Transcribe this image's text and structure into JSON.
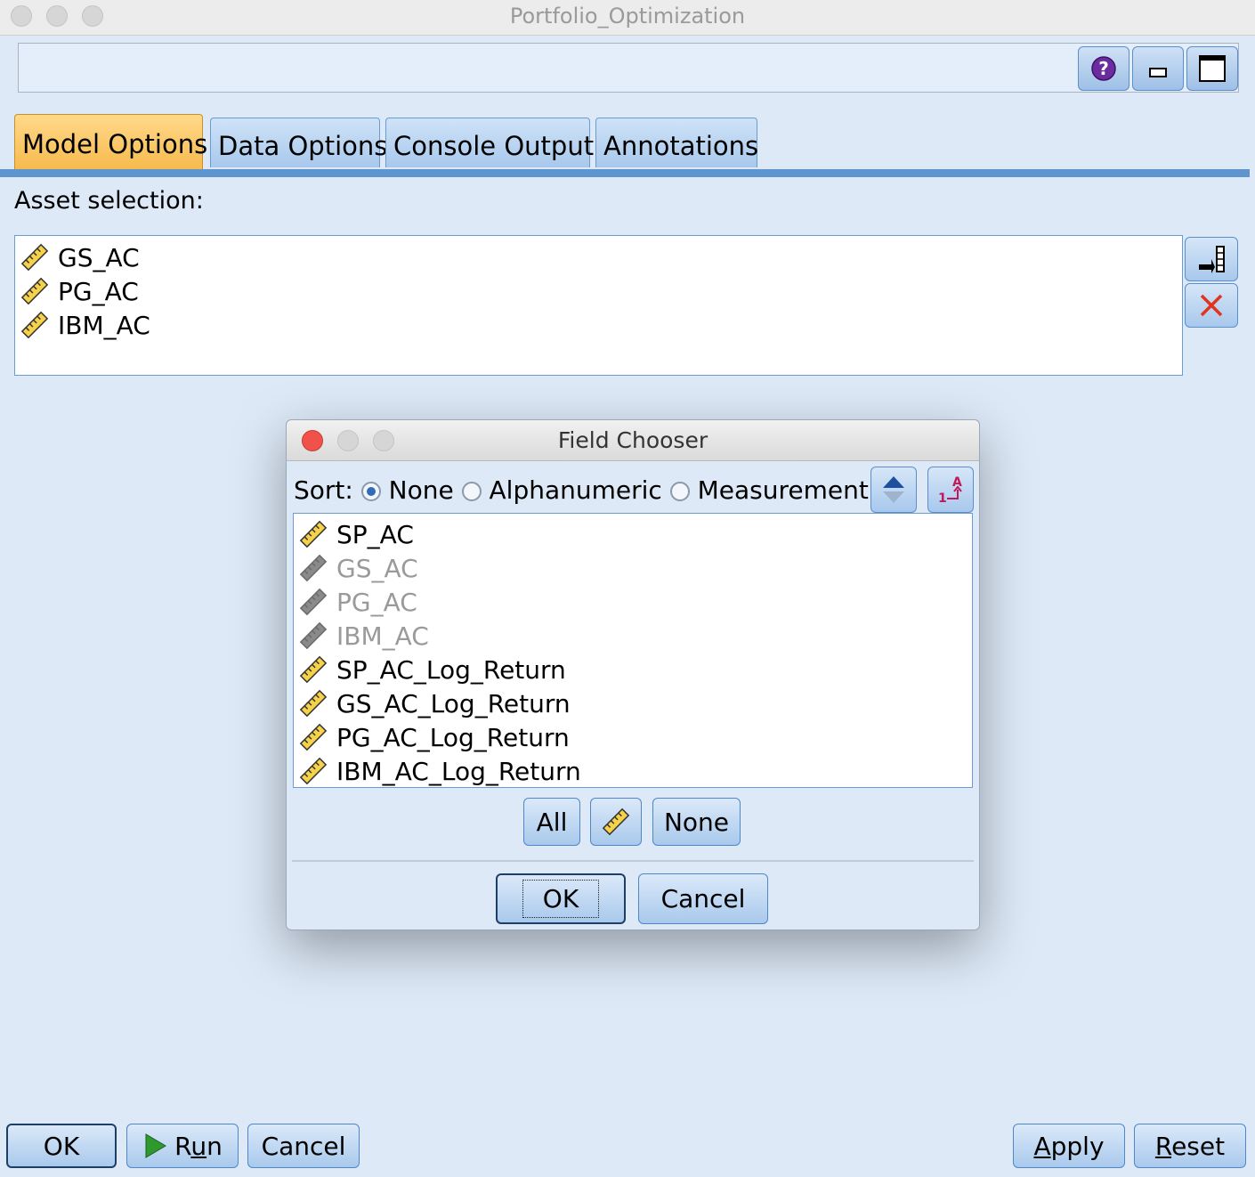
{
  "window": {
    "title": "Portfolio_Optimization"
  },
  "toolbar": {
    "help_icon": "help-icon",
    "minimize_icon": "minimize-icon",
    "maximize_icon": "maximize-icon"
  },
  "tabs": [
    {
      "label": "Model Options",
      "active": true
    },
    {
      "label": "Data Options",
      "active": false
    },
    {
      "label": "Console Output",
      "active": false
    },
    {
      "label": "Annotations",
      "active": false
    }
  ],
  "asset_selection": {
    "label": "Asset selection:",
    "items": [
      "GS_AC",
      "PG_AC",
      "IBM_AC"
    ],
    "item_icon": "continuous-ruler-icon"
  },
  "field_chooser": {
    "title": "Field Chooser",
    "sort_label": "Sort:",
    "sort_options": [
      {
        "label": "None",
        "selected": true
      },
      {
        "label": "Alphanumeric",
        "selected": false
      },
      {
        "label": "Measurement",
        "selected": false
      }
    ],
    "fields": [
      {
        "name": "SP_AC",
        "enabled": true
      },
      {
        "name": "GS_AC",
        "enabled": false
      },
      {
        "name": "PG_AC",
        "enabled": false
      },
      {
        "name": "IBM_AC",
        "enabled": false
      },
      {
        "name": "SP_AC_Log_Return",
        "enabled": true
      },
      {
        "name": "GS_AC_Log_Return",
        "enabled": true
      },
      {
        "name": "PG_AC_Log_Return",
        "enabled": true
      },
      {
        "name": "IBM_AC_Log_Return",
        "enabled": true
      }
    ],
    "select_all": "All",
    "select_none": "None",
    "ok": "OK",
    "cancel": "Cancel"
  },
  "footer": {
    "ok": "OK",
    "run_pre": "R",
    "run_u": "u",
    "run_post": "n",
    "cancel": "Cancel",
    "apply_u": "A",
    "apply_post": "pply",
    "reset_u": "R",
    "reset_post": "eset"
  },
  "colors": {
    "accent_tab": "#f7b94c",
    "background": "#dde9f7",
    "button_border": "#4f87c8"
  }
}
